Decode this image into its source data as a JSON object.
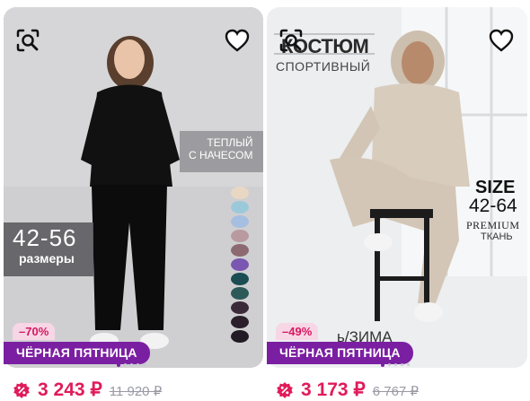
{
  "products": [
    {
      "discount": "–70%",
      "promo": "ЧЁРНАЯ ПЯТНИЦА",
      "price": "3 243 ₽",
      "old_price": "11 920 ₽",
      "photo_text": {
        "warm_line1": "ТЕПЛЫЙ",
        "warm_line2": "С НАЧЕСОМ",
        "size_range": "42-56",
        "size_label": "размеры"
      },
      "swatches": [
        "#e8d8c3",
        "#9cc9da",
        "#a6bfe0",
        "#b89aa0",
        "#8d6a72",
        "#7a57b0",
        "#1b4d52",
        "#2d5a58",
        "#3b2b3a",
        "#2a1f2b",
        "#221a24"
      ]
    },
    {
      "discount": "–49%",
      "promo": "ЧЁРНАЯ ПЯТНИЦА",
      "price": "3 173 ₽",
      "old_price": "6 767 ₽",
      "photo_text": {
        "title": "КОСТЮМ",
        "subtitle": "СПОРТИВНЫЙ",
        "size_word": "SIZE",
        "size_range": "42-64",
        "premium": "PREMIUM",
        "fabric": "ТКАНЬ",
        "season": "ь/ЗИМА"
      }
    }
  ],
  "icons": {
    "zoom": "search-image-icon",
    "favorite": "heart-outline-icon",
    "price_badge": "discount-percent-icon"
  },
  "colors": {
    "price": "#e01b5a",
    "promo_bg": "#7b1fa2",
    "discount_bg": "#f7d6e6"
  }
}
